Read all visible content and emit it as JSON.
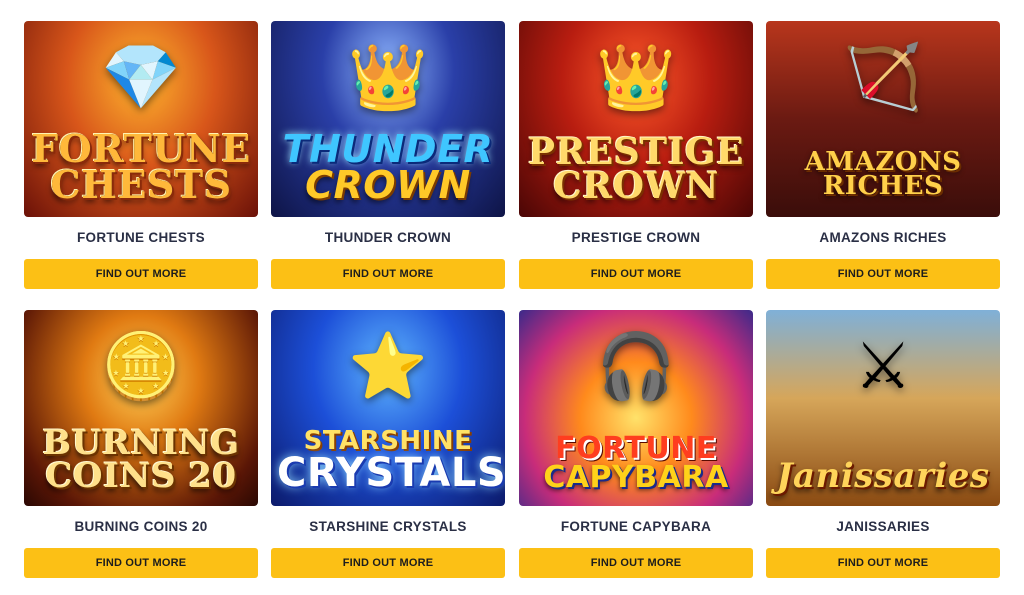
{
  "games": [
    {
      "title": "FORTUNE CHESTS",
      "logo_line1": "FORTUNE",
      "logo_line2": "CHESTS",
      "art_glyph": "💎",
      "button_label": "FIND OUT MORE"
    },
    {
      "title": "THUNDER CROWN",
      "logo_line1": "THUNDER",
      "logo_line2": "CROWN",
      "art_glyph": "👑",
      "button_label": "FIND OUT MORE"
    },
    {
      "title": "PRESTIGE CROWN",
      "logo_line1": "PRESTIGE",
      "logo_line2": "CROWN",
      "art_glyph": "👑",
      "button_label": "FIND OUT MORE"
    },
    {
      "title": "AMAZONS RICHES",
      "logo_line1": "AMAZONS",
      "logo_line2": "RICHES",
      "art_glyph": "🏹",
      "button_label": "FIND OUT MORE"
    },
    {
      "title": "BURNING COINS 20",
      "logo_line1": "BURNING",
      "logo_line2": "COINS 20",
      "art_glyph": "🪙",
      "button_label": "FIND OUT MORE"
    },
    {
      "title": "STARSHINE CRYSTALS",
      "logo_line1": "STARSHINE",
      "logo_line2": "CRYSTALS",
      "art_glyph": "⭐",
      "button_label": "FIND OUT MORE"
    },
    {
      "title": "FORTUNE CAPYBARA",
      "logo_line1": "FORTUNE",
      "logo_line2": "CAPYBARA",
      "art_glyph": "🎧",
      "button_label": "FIND OUT MORE"
    },
    {
      "title": "JANISSARIES",
      "logo_line1": "Janissaries",
      "logo_line2": "",
      "art_glyph": "⚔",
      "button_label": "FIND OUT MORE"
    }
  ],
  "colors": {
    "button_bg": "#fcc015",
    "button_text": "#1d1d1d",
    "title_text": "#2a2f45",
    "page_bg": "#ffffff"
  }
}
